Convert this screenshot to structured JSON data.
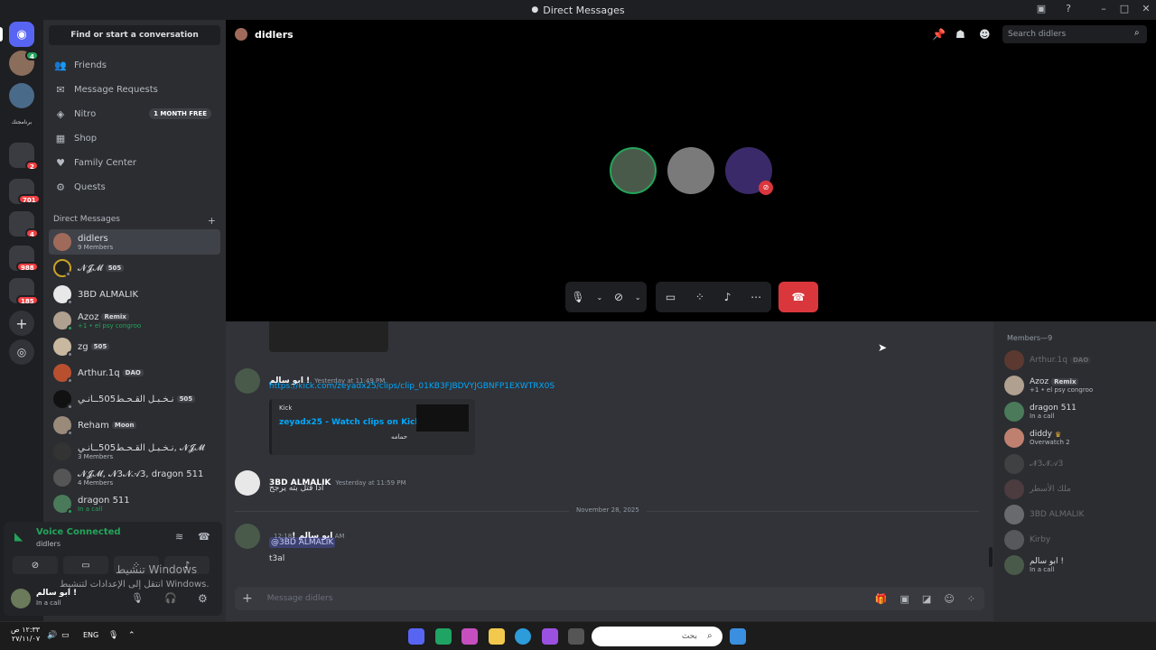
{
  "window": {
    "title": "Direct Messages"
  },
  "servers": {
    "badges": [
      "2",
      "701",
      "4",
      "988",
      "185"
    ],
    "label_under_second": "برنامجتك"
  },
  "sidebar": {
    "find_label": "Find or start a conversation",
    "nav": [
      {
        "label": "Friends",
        "icon": "friends-icon"
      },
      {
        "label": "Message Requests",
        "icon": "mail-icon"
      },
      {
        "label": "Nitro",
        "icon": "nitro-icon",
        "badge": "1 MONTH FREE"
      },
      {
        "label": "Shop",
        "icon": "shop-icon"
      },
      {
        "label": "Family Center",
        "icon": "family-icon"
      },
      {
        "label": "Quests",
        "icon": "quests-icon"
      }
    ],
    "dm_header": "Direct Messages",
    "dms": [
      {
        "name": "didlers",
        "sub": "9 Members"
      },
      {
        "name": "𝓝𝓙𝓜",
        "tag": "505"
      },
      {
        "name": "3BD ALMALIK"
      },
      {
        "name": "Azoz",
        "tag": "Remix",
        "sub": "+1 • el psy congroo"
      },
      {
        "name": "zg",
        "tag": "505"
      },
      {
        "name": "Arthur.1q",
        "tag": "DAO"
      },
      {
        "name": "نـخـبـل القـحـط505ــانـي",
        "tag": "505"
      },
      {
        "name": "Reham",
        "tag": "Moon"
      },
      {
        "name": "نـخـبـل القـحـط505ــانـي, 𝓝𝓙𝓜",
        "sub": "3 Members"
      },
      {
        "name": "𝓝𝓙𝓜, 𝓝3𝓝𝒜3, dragon 511",
        "sub": "4 Members"
      },
      {
        "name": "dragon 511",
        "sub": "In a call"
      }
    ]
  },
  "voice": {
    "title": "Voice Connected",
    "channel": "didlers",
    "user_name": "ابو سالم !",
    "user_status": "In a call",
    "activate_title": "تنشيط Windows",
    "activate_sub": "انتقل إلى الإعدادات لتنشيط Windows."
  },
  "call": {
    "title": "didlers",
    "search_placeholder": "Search didlers"
  },
  "chat": {
    "messages": [
      {
        "author": "ابو سالم !",
        "time": "Yesterday at 11:49 PM",
        "link": "https://kick.com/zeyadx25/clips/clip_01KB3FJBDVYJGBNFP1EXWTRX0S"
      },
      {
        "author": "3BD ALMALIK",
        "time": "Yesterday at 11:59 PM",
        "text": "اذا قتل بته يرجح"
      },
      {
        "author": "ابو سالم !",
        "time": "12:18 AM",
        "mention": "@3BD ALMALIK",
        "text": "t3al"
      }
    ],
    "embed": {
      "provider": "Kick",
      "title": "zeyadx25 - Watch clips on Kick",
      "desc": "حمامه"
    },
    "divider": "November 28, 2025",
    "composer_placeholder": "Message didlers"
  },
  "members": {
    "header": "Members—9",
    "list": [
      {
        "name": "Arthur.1q",
        "tag": "DAO",
        "offline": true
      },
      {
        "name": "Azoz",
        "tag": "Remix",
        "sub": "+1 • el psy congroo"
      },
      {
        "name": "dragon 511",
        "sub": "In a call"
      },
      {
        "name": "diddy",
        "sub": "Overwatch 2"
      },
      {
        "name": "𝓝3𝓝𝒜3",
        "offline": true
      },
      {
        "name": "ملك الأسطر",
        "offline": true
      },
      {
        "name": "3BD ALMALIK",
        "offline": true
      },
      {
        "name": "Kirby",
        "offline": true
      },
      {
        "name": "ابو سالم !",
        "sub": "In a call"
      }
    ]
  },
  "taskbar": {
    "search_placeholder": "بحث",
    "time": "١٢:٣٣ ص",
    "date": "٢٧/١١/٠٧",
    "lang": "ENG"
  },
  "colors": {
    "accent": "#5865f2",
    "green": "#23a55a",
    "red": "#da373c",
    "link": "#00a8fc"
  }
}
